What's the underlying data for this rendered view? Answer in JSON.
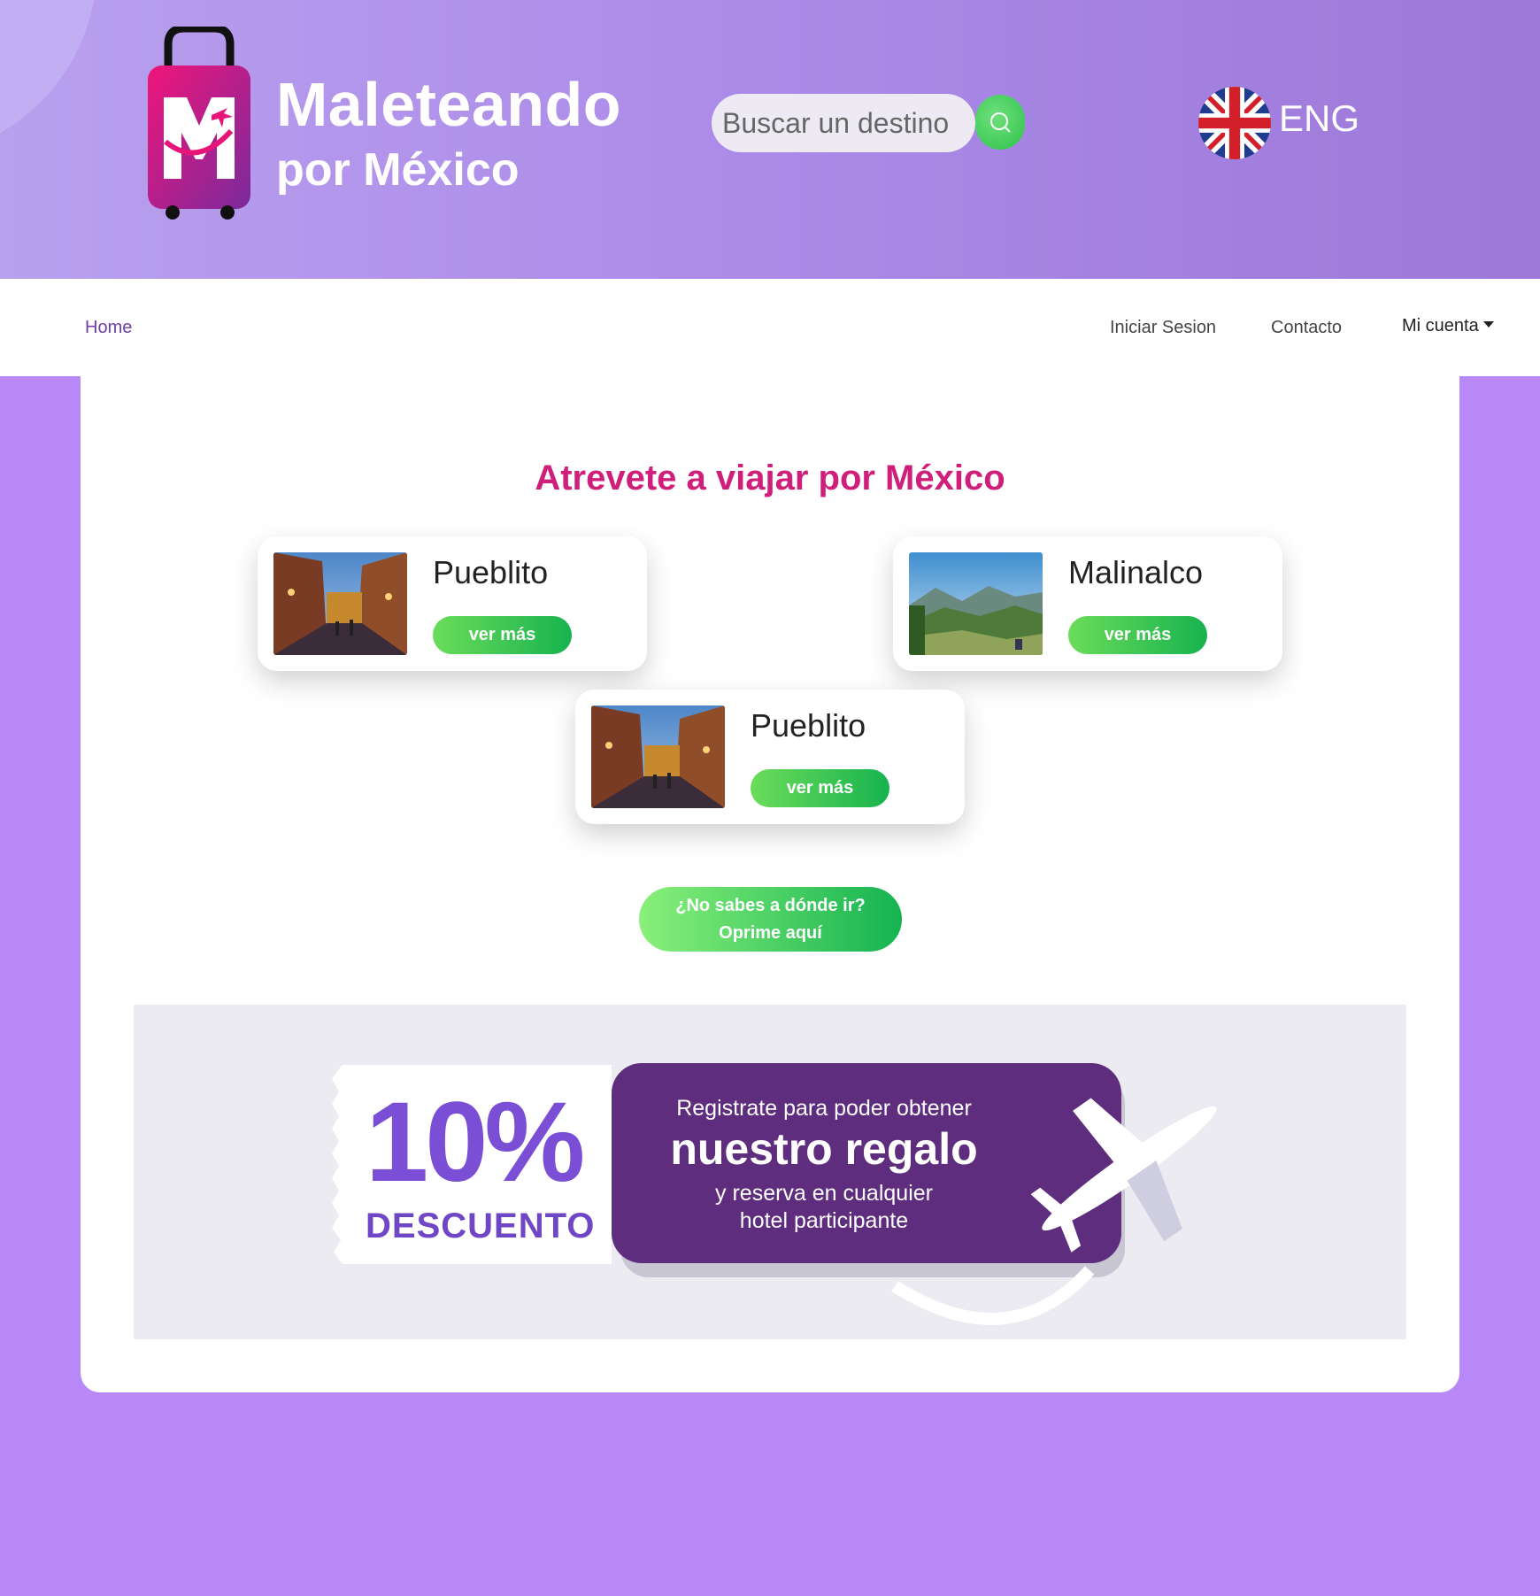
{
  "brand": {
    "name_line1": "Maleteando",
    "name_line2": "por México"
  },
  "search": {
    "placeholder": "Buscar un destino"
  },
  "language": {
    "label": "ENG"
  },
  "nav": {
    "home": "Home",
    "login": "Iniciar Sesion",
    "contact": "Contacto",
    "account": "Mi cuenta"
  },
  "main": {
    "title": "Atrevete a viajar por México",
    "destinations": [
      {
        "name": "Pueblito",
        "button": "ver más"
      },
      {
        "name": "Malinalco",
        "button": "ver más"
      },
      {
        "name": "Pueblito",
        "button": "ver más"
      }
    ],
    "cta": {
      "line1": "¿No sabes a dónde ir?",
      "line2": "Oprime aquí"
    }
  },
  "promo": {
    "percent": "10%",
    "discount": "DESCUENTO",
    "line1": "Registrate para poder obtener",
    "line2": "nuestro regalo",
    "line3": "y reserva en cualquier",
    "line4": "hotel participante"
  },
  "colors": {
    "page_bg": "#b887f8",
    "title": "#cf1f7a",
    "button_green": "#17b34f",
    "promo_purple": "#5e2d7e"
  }
}
